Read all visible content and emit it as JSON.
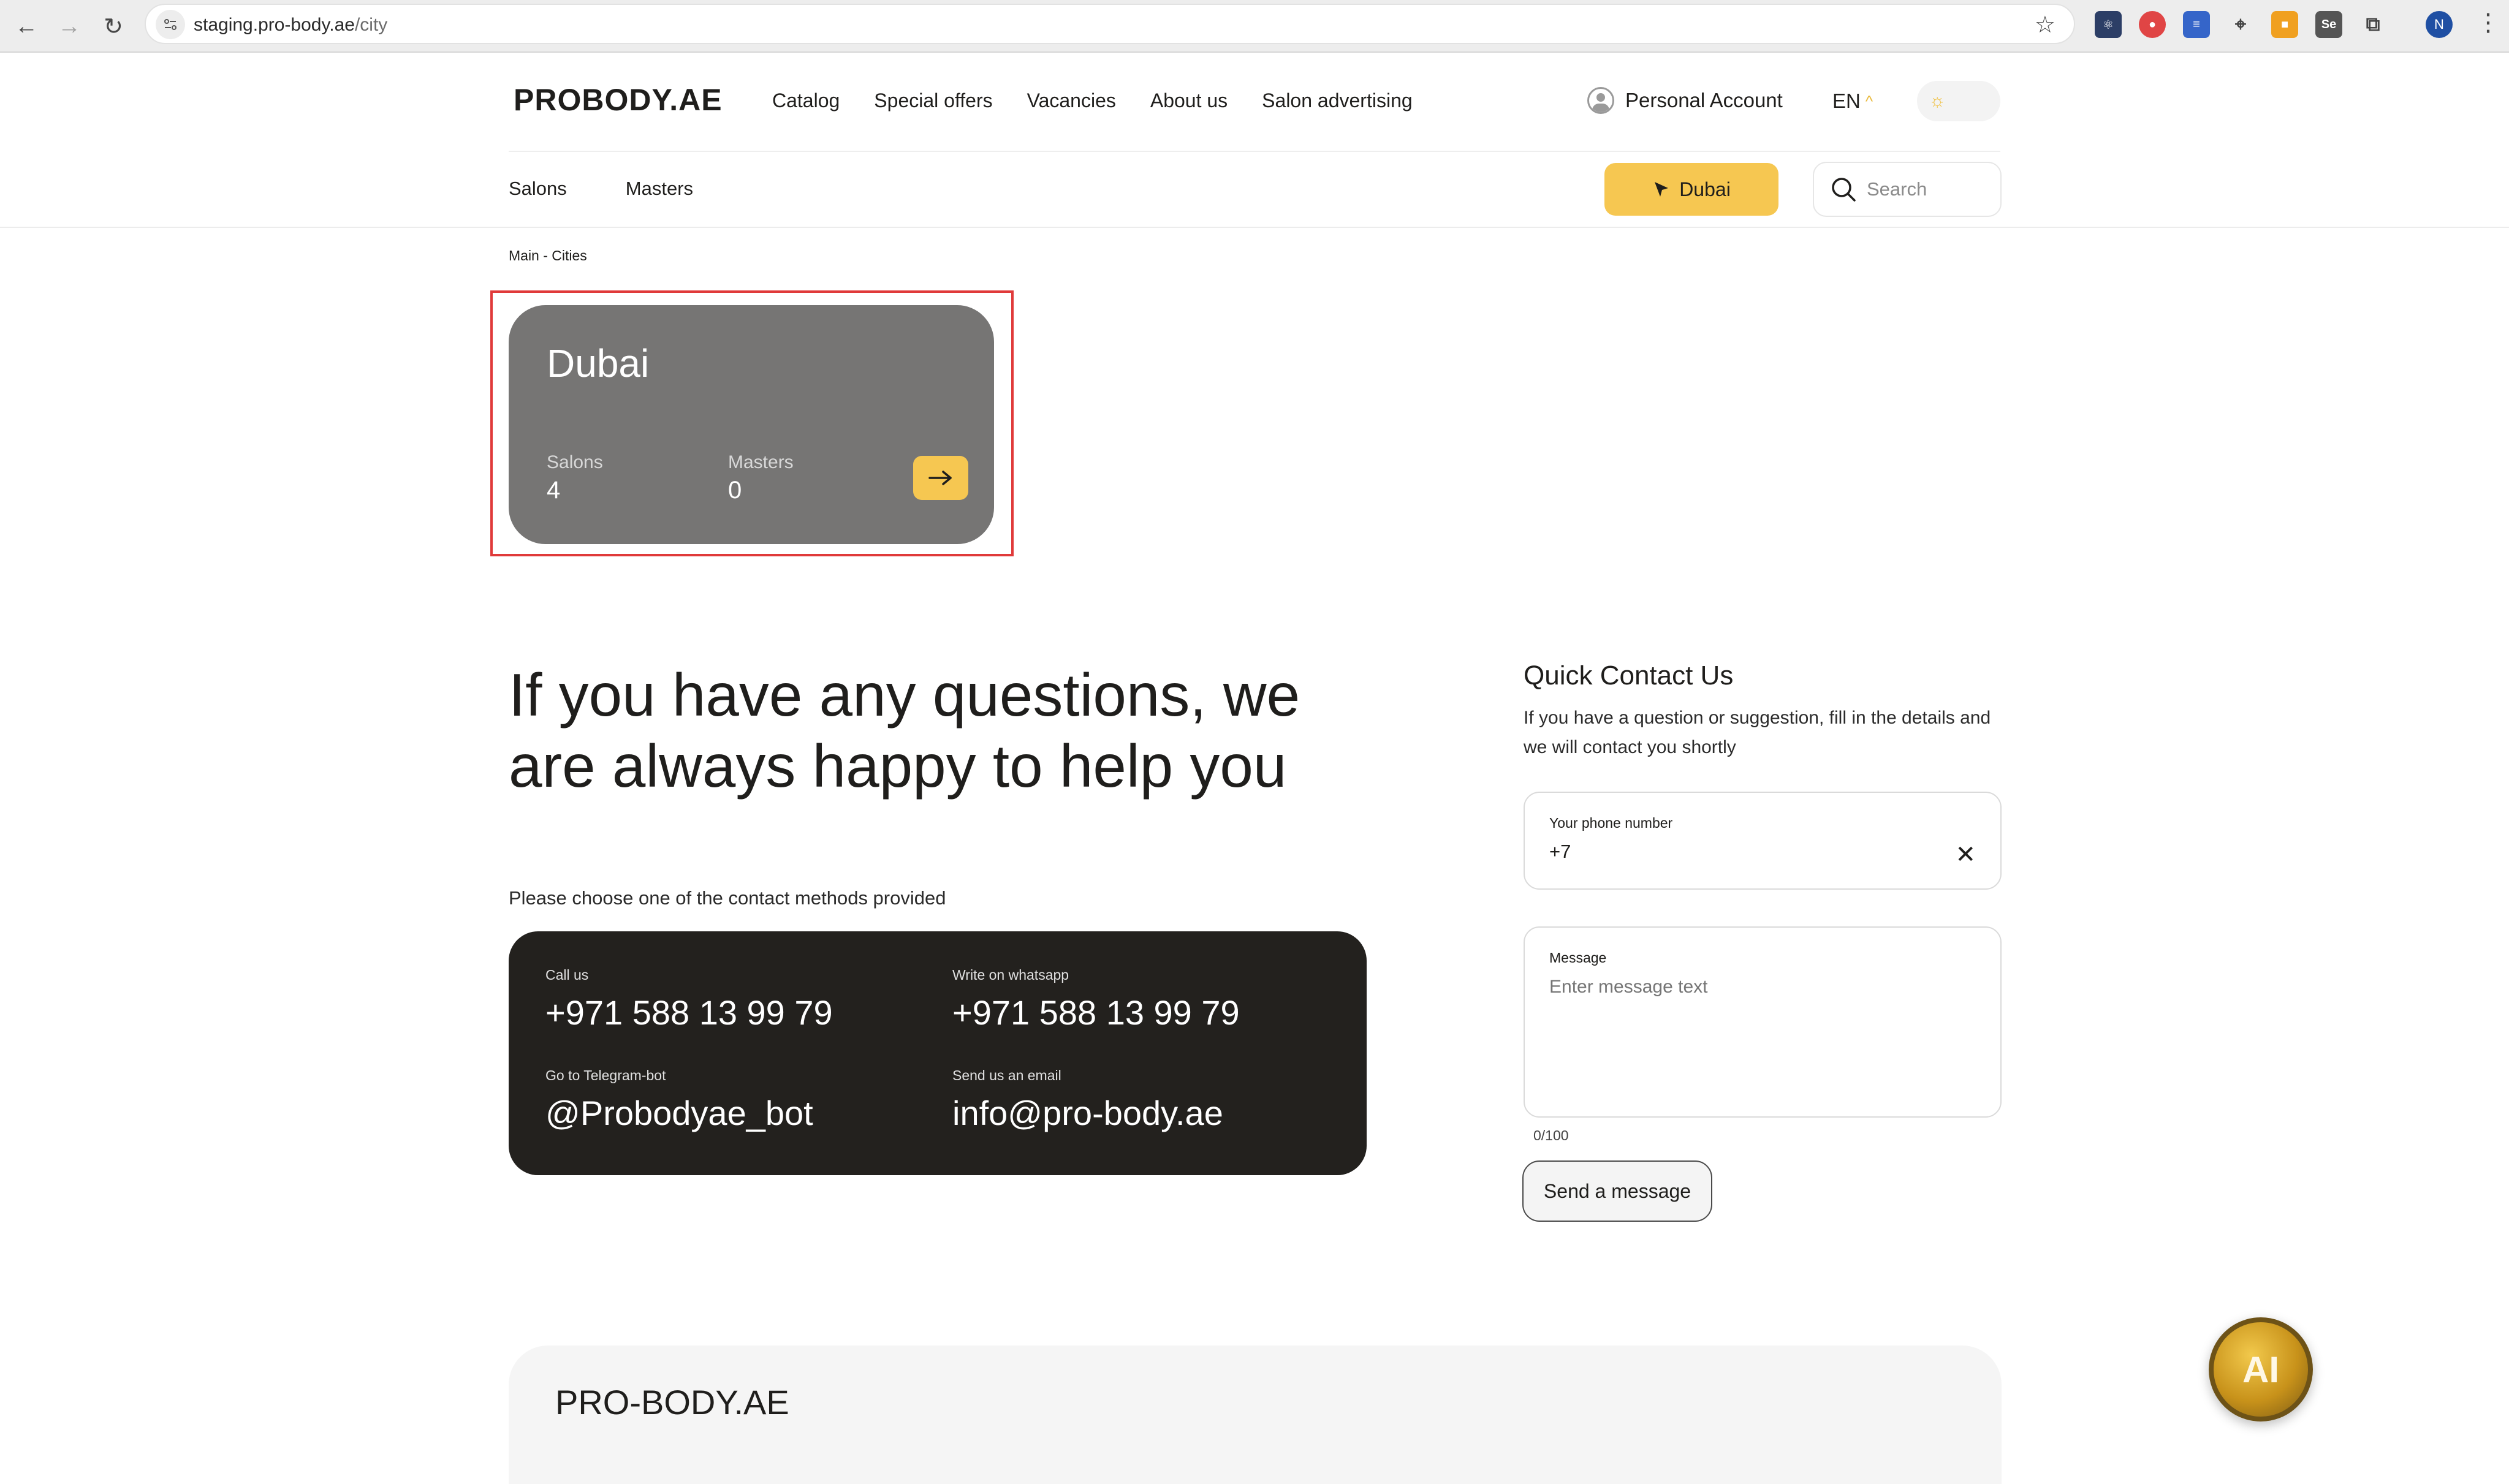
{
  "browser": {
    "url_host": "staging.pro-body.ae",
    "url_path": "/city",
    "profile_initial": "N"
  },
  "header": {
    "logo": "PROBODY.AE",
    "nav": [
      "Catalog",
      "Special offers",
      "Vacancies",
      "About us",
      "Salon advertising"
    ],
    "account_label": "Personal Account",
    "language": "EN"
  },
  "subnav": {
    "items": [
      "Salons",
      "Masters"
    ],
    "city_button": "Dubai",
    "search_placeholder": "Search"
  },
  "breadcrumb": "Main - Cities",
  "city_card": {
    "name": "Dubai",
    "salons_label": "Salons",
    "salons_count": "4",
    "masters_label": "Masters",
    "masters_count": "0"
  },
  "help": {
    "heading": "If you have any questions, we are always happy to help you",
    "subtitle": "Please choose one of the contact methods provided",
    "contacts": {
      "call_label": "Call us",
      "call_value": "+971 588 13 99 79",
      "whatsapp_label": "Write on whatsapp",
      "whatsapp_value": "+971 588 13 99 79",
      "telegram_label": "Go to Telegram-bot",
      "telegram_value": "@Probodyae_bot",
      "email_label": "Send us an email",
      "email_value": "info@pro-body.ae"
    }
  },
  "quick_contact": {
    "title": "Quick Contact Us",
    "description": "If you have a question or suggestion, fill in the details and we will contact you shortly",
    "phone_label": "Your phone number",
    "phone_value": "+7",
    "message_label": "Message",
    "message_placeholder": "Enter message text",
    "counter": "0/100",
    "send_label": "Send a message"
  },
  "footer": {
    "logo": "PRO-BODY.AE"
  },
  "ai_button": "AI",
  "colors": {
    "accent": "#f6c751",
    "card_gray": "#767574",
    "dark_card": "#23211e",
    "highlight": "#e03a3a"
  }
}
